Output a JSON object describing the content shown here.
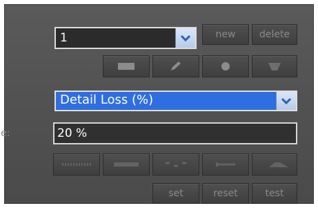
{
  "profile": {
    "selected": "1"
  },
  "buttons": {
    "new": "new",
    "delete": "delete",
    "set": "set",
    "reset": "reset",
    "test": "test"
  },
  "tools": [
    "rectangle-tool-icon",
    "pencil-tool-icon",
    "circle-tool-icon",
    "bucket-tool-icon"
  ],
  "metric": {
    "selected": "Detail Loss (%)",
    "side_label": "e:",
    "value": "20 %"
  },
  "presets": [
    "dotted-line-icon",
    "solid-bar-icon",
    "dashed-line-icon",
    "arrow-line-icon",
    "ramp-icon"
  ],
  "colors": {
    "panel": "#555555",
    "selection_blue": "#2f6ee0",
    "chevron_arrow": "#2f5fa8"
  }
}
